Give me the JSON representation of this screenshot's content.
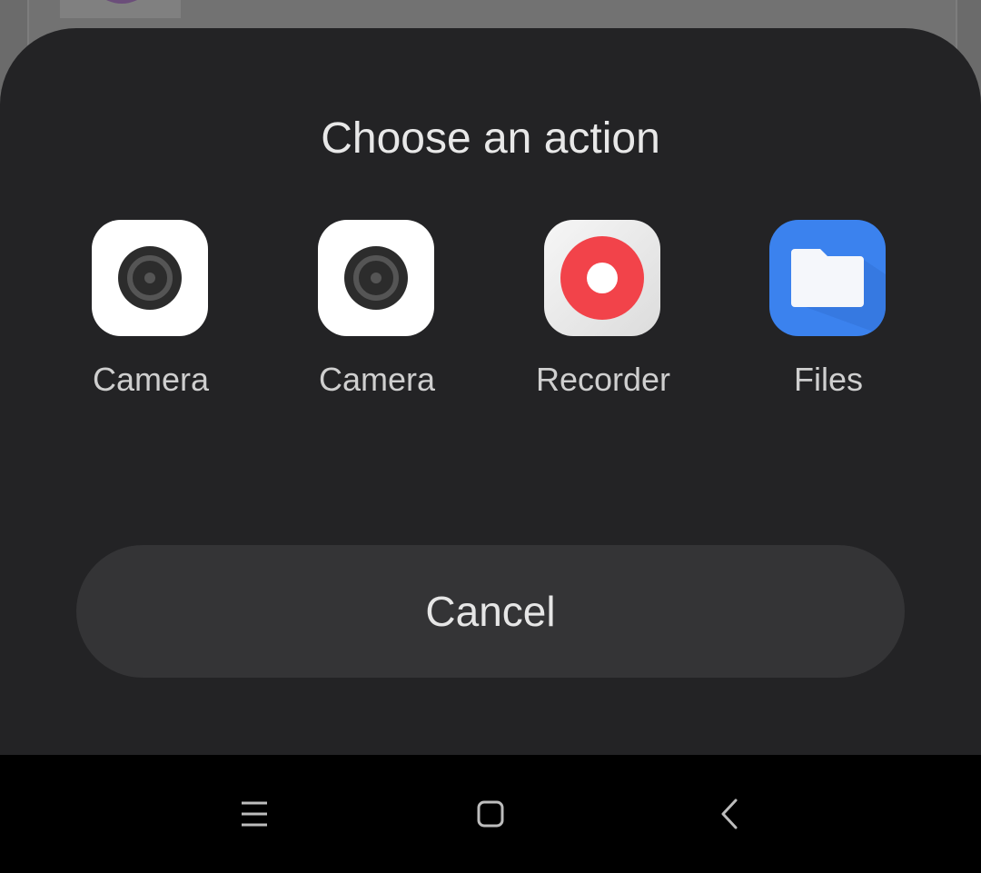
{
  "sheet": {
    "title": "Choose an action",
    "apps": [
      {
        "label": "Camera",
        "icon": "camera-icon"
      },
      {
        "label": "Camera",
        "icon": "camera-icon"
      },
      {
        "label": "Recorder",
        "icon": "recorder-icon"
      },
      {
        "label": "Files",
        "icon": "files-icon"
      }
    ],
    "cancel_label": "Cancel"
  },
  "navbar": {
    "icons": [
      "menu-icon",
      "home-icon",
      "back-icon"
    ]
  },
  "colors": {
    "sheet_bg": "#232325",
    "button_bg": "#343436",
    "recorder_red": "#f2434a",
    "files_blue": "#3b82ee"
  }
}
